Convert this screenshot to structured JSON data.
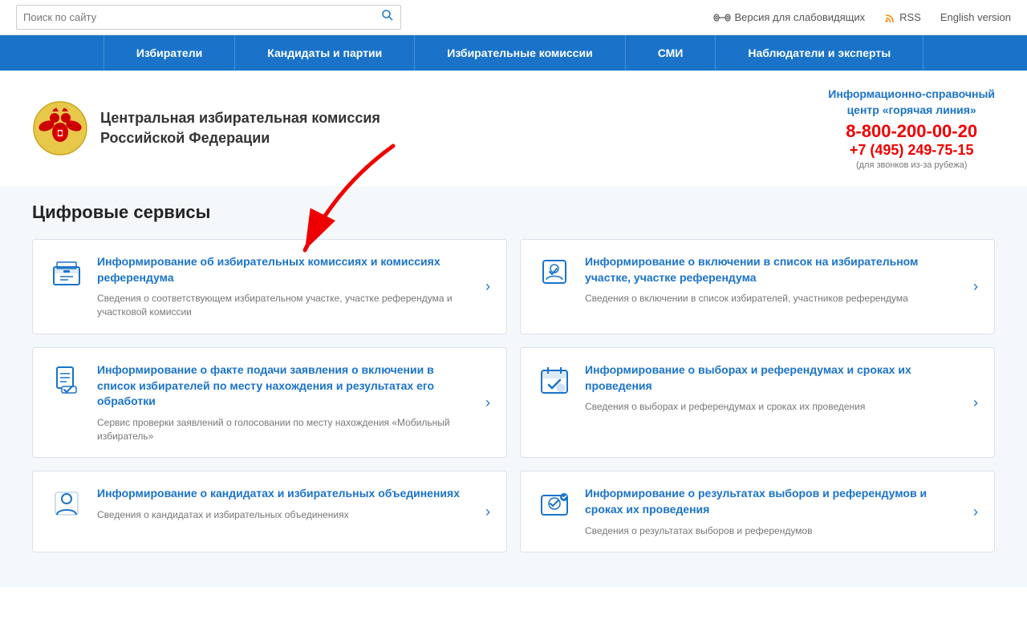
{
  "topbar": {
    "search_placeholder": "Поиск по сайту",
    "accessibility_label": "Версия для слабовидящих",
    "rss_label": "RSS",
    "english_label": "English version"
  },
  "nav": {
    "items": [
      "Избиратели",
      "Кандидаты и партии",
      "Избирательные комиссии",
      "СМИ",
      "Наблюдатели и эксперты"
    ]
  },
  "header": {
    "org_line1": "Центральная избирательная комиссия",
    "org_line2": "Российской Федерации",
    "hotline_title_line1": "Информационно-справочный",
    "hotline_title_line2": "центр «горячая линия»",
    "phone1": "8-800-200-00-20",
    "phone2": "+7 (495) 249-75-15",
    "phone_note": "(для звонков из-за рубежа)"
  },
  "main": {
    "section_title": "Цифровые сервисы",
    "cards": [
      {
        "title": "Информирование об избирательных комиссиях и комиссиях референдума",
        "desc": "Сведения о соответствующем избирательном участке, участке референдума и участковой комиссии",
        "icon": "ballot-box"
      },
      {
        "title": "Информирование о включении в список на избирательном участке, участке референдума",
        "desc": "Сведения о включении в список избирателей, участников референдума",
        "icon": "checklist"
      },
      {
        "title": "Информирование о факте подачи заявления о включении в список избирателей по месту нахождения и результатах его обработки",
        "desc": "Сервис проверки заявлений о голосовании по месту нахождения «Мобильный избиратель»",
        "icon": "document-list"
      },
      {
        "title": "Информирование о выборах и референдумах и сроках их проведения",
        "desc": "Сведения о выборах и референдумах и сроках их проведения",
        "icon": "calendar-check"
      },
      {
        "title": "Информирование о кандидатах и избирательных объединениях",
        "desc": "Сведения о кандидатах и избирательных объединениях",
        "icon": "person-card"
      },
      {
        "title": "Информирование о результатах выборов и референдумов и сроках их проведения",
        "desc": "Сведения о результатах выборов и референдумов",
        "icon": "results-check"
      }
    ]
  }
}
